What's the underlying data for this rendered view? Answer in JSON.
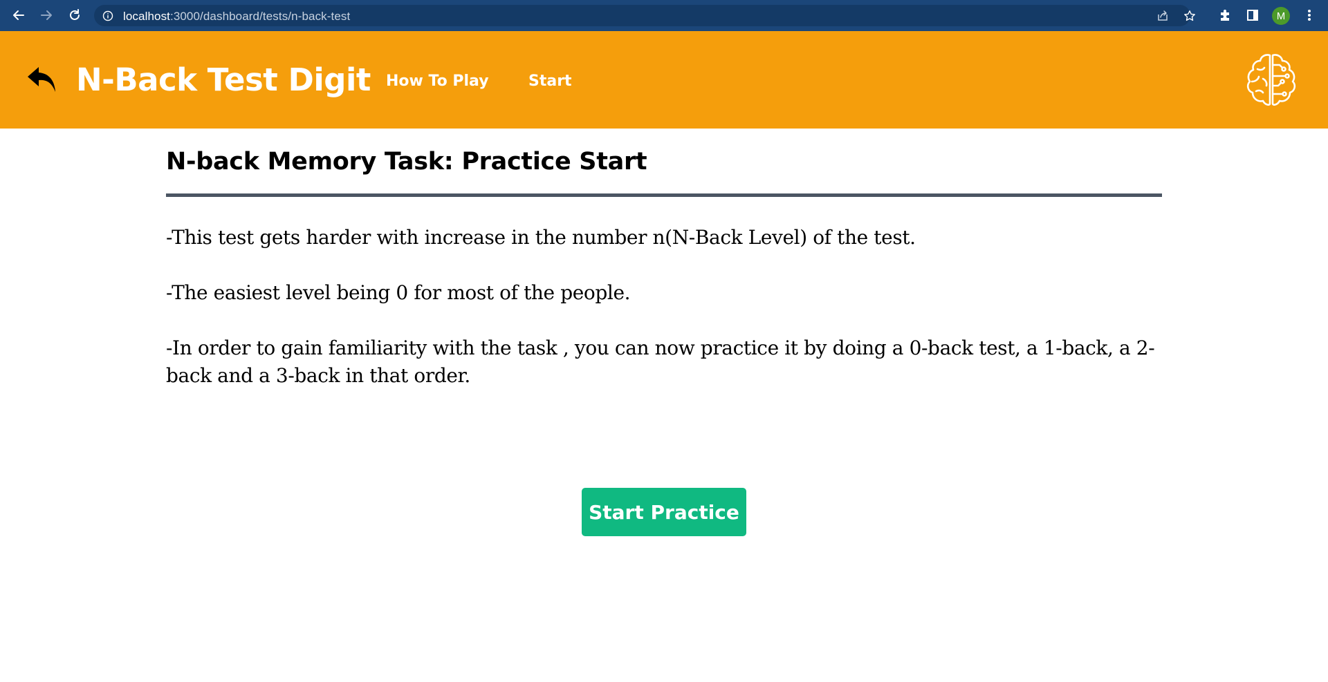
{
  "browser": {
    "url_host": "localhost",
    "url_path": ":3000/dashboard/tests/n-back-test",
    "profile_initial": "M",
    "icons": [
      "back-arrow-icon",
      "forward-arrow-icon",
      "reload-icon",
      "info-icon",
      "share-icon",
      "star-icon",
      "extensions-icon",
      "side-panel-icon",
      "more-vert-icon"
    ]
  },
  "header": {
    "title": "N-Back Test Digit",
    "nav": [
      {
        "label": "How To Play"
      },
      {
        "label": "Start"
      }
    ],
    "icons": [
      "back-reply-icon",
      "brain-circuit-icon"
    ],
    "background_color": "#f59e0c"
  },
  "main": {
    "title": "N-back Memory Task: Practice Start",
    "paragraphs": [
      "-This test gets harder with increase in the number n(N-Back Level) of the test.",
      "-The easiest level being 0 for most of the people.",
      "-In order to gain familiarity with the task , you can now practice it by doing a 0-back test, a 1-back, a 2-back and a 3-back in that order."
    ],
    "button_label": "Start Practice",
    "button_color": "#10b981"
  }
}
